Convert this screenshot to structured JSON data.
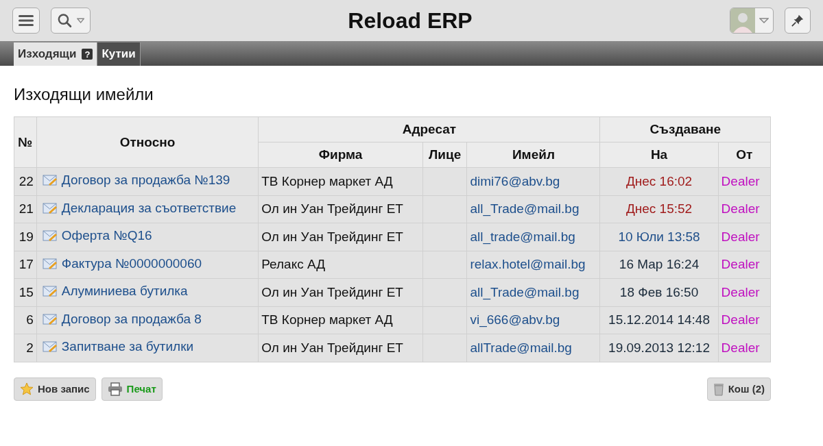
{
  "app_title": "Reload ERP",
  "tabs": [
    {
      "label": "Изходящи",
      "selected": true,
      "help": "?"
    },
    {
      "label": "Кутии",
      "selected": false
    }
  ],
  "page_title": "Изходящи имейли",
  "table": {
    "columns": {
      "number": "№",
      "subject": "Относно",
      "recipient_group": "Адресат",
      "company": "Фирма",
      "person": "Лице",
      "email": "Имейл",
      "created_group": "Създаване",
      "created_on": "На",
      "created_by": "От"
    },
    "rows": [
      {
        "number": "22",
        "subject": "Договор за продажба №139",
        "company": "ТВ Корнер маркет АД",
        "email": "dimi76@abv.bg",
        "created_on": {
          "text": "Днес 16:02",
          "color": "#a01c1c"
        },
        "created_by": "Dealer"
      },
      {
        "number": "21",
        "subject": "Декларация за съответствие",
        "company": "Ол ин Уан Трейдинг ЕТ",
        "email": "all_Trade@mail.bg",
        "created_on": {
          "text": "Днес 15:52",
          "color": "#a01c1c"
        },
        "created_by": "Dealer"
      },
      {
        "number": "19",
        "subject": "Оферта №Q16",
        "company": "Ол ин Уан Трейдинг ЕТ",
        "email": "all_trade@mail.bg",
        "created_on": {
          "text": "10 Юли 13:58",
          "color": "#1f4f8a"
        },
        "created_by": "Dealer"
      },
      {
        "number": "17",
        "subject": "Фактура №0000000060",
        "company": "Релакс АД",
        "email": "relax.hotel@mail.bg",
        "created_on": {
          "text": "16 Мар 16:24",
          "color": "#1a2a3a"
        },
        "created_by": "Dealer"
      },
      {
        "number": "15",
        "subject": "Алуминиева бутилка",
        "company": "Ол ин Уан Трейдинг ЕТ",
        "email": "all_Trade@mail.bg",
        "created_on": {
          "text": "18 Фев 16:50",
          "color": "#1a2a3a"
        },
        "created_by": "Dealer"
      },
      {
        "number": "6",
        "subject": "Договор за продажба 8",
        "company": "ТВ Корнер маркет АД",
        "email": "vi_666@abv.bg",
        "created_on": {
          "text": "15.12.2014 14:48",
          "color": "#1a2a3a"
        },
        "created_by": "Dealer"
      },
      {
        "number": "2",
        "subject": "Запитване за бутилки",
        "company": "Ол ин Уан Трейдинг ЕТ",
        "email": "allTrade@mail.bg",
        "created_on": {
          "text": "19.09.2013 12:12",
          "color": "#1a2a3a"
        },
        "created_by": "Dealer"
      }
    ]
  },
  "buttons": {
    "new": "Нов запис",
    "print": "Печат",
    "trash": "Кош (2)"
  }
}
